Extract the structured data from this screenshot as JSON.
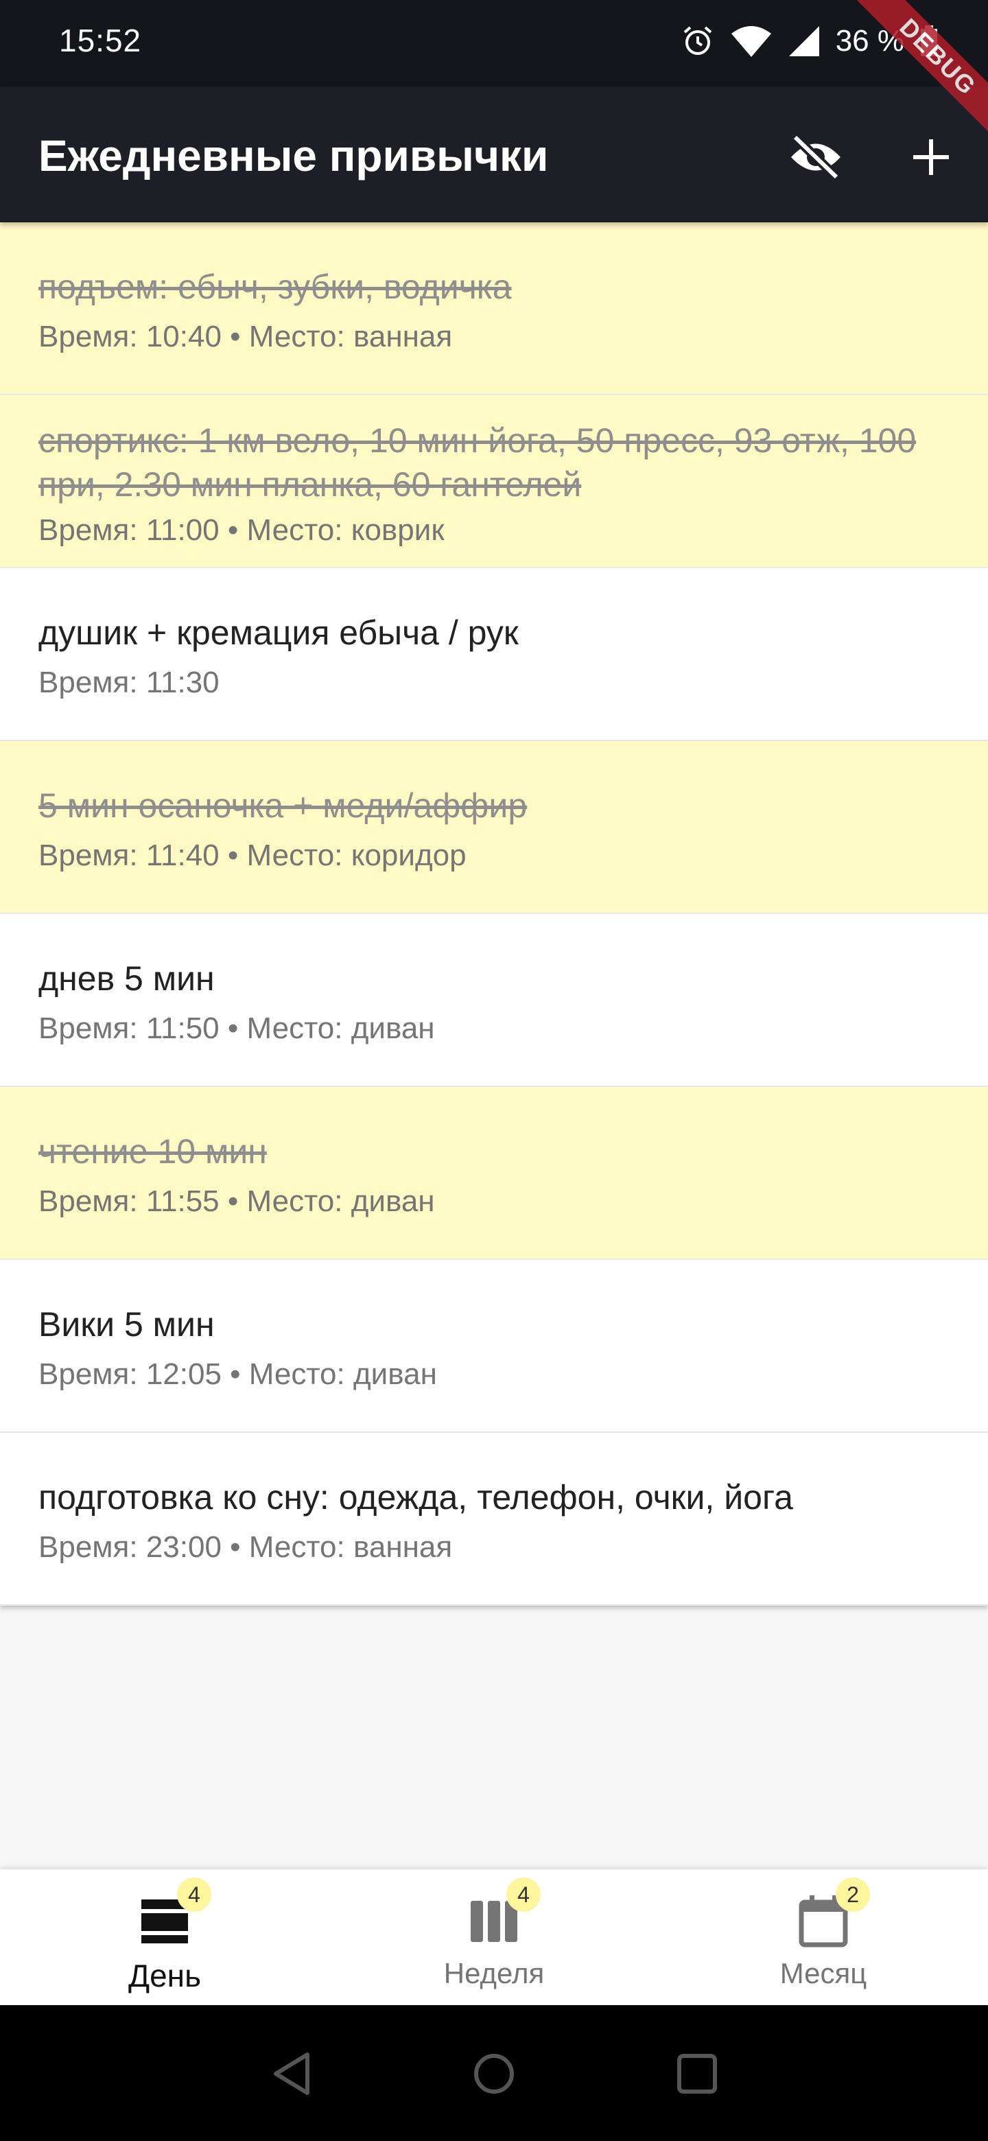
{
  "status_bar": {
    "time": "15:52",
    "battery": "36 %",
    "icons": [
      "alarm-icon",
      "wifi-icon",
      "signal-icon",
      "battery-icon"
    ]
  },
  "debug_label": "DEBUG",
  "app_bar": {
    "title": "Ежедневные привычки",
    "actions": [
      "hide-completed-icon",
      "add-icon"
    ]
  },
  "habits": [
    {
      "title": "подъем: ебыч, зубки, водичка",
      "subtitle": "Время: 10:40 • Место: ванная",
      "done": true
    },
    {
      "title": "спортикс: 1 км вело, 10 мин йога, 50 пресс, 93 отж, 100 при, 2.30 мин планка, 60 гантелей",
      "subtitle": "Время: 11:00 • Место: коврик",
      "done": true
    },
    {
      "title": "душик + кремация ебыча / рук",
      "subtitle": "Время: 11:30",
      "done": false
    },
    {
      "title": "5 мин осаночка + меди/аффир",
      "subtitle": "Время: 11:40 • Место: коридор",
      "done": true
    },
    {
      "title": "днев 5 мин",
      "subtitle": "Время: 11:50 • Место: диван",
      "done": false
    },
    {
      "title": "чтение 10 мин",
      "subtitle": "Время: 11:55 • Место: диван",
      "done": true
    },
    {
      "title": "Вики 5 мин",
      "subtitle": "Время: 12:05 • Место: диван",
      "done": false
    },
    {
      "title": "подготовка ко сну: одежда, телефон, очки, йога",
      "subtitle": "Время: 23:00 • Место: ванная",
      "done": false
    }
  ],
  "bottom_nav": {
    "items": [
      {
        "label": "День",
        "badge": "4",
        "icon": "day-view-icon",
        "active": true
      },
      {
        "label": "Неделя",
        "badge": "4",
        "icon": "week-view-icon",
        "active": false
      },
      {
        "label": "Месяц",
        "badge": "2",
        "icon": "calendar-icon",
        "active": false
      }
    ]
  },
  "colors": {
    "app_bar": "#1e1f26",
    "status_bar": "#15161b",
    "done_row": "#fff9c4",
    "badge": "#fff59d",
    "debug_ribbon": "#b01e2b"
  }
}
